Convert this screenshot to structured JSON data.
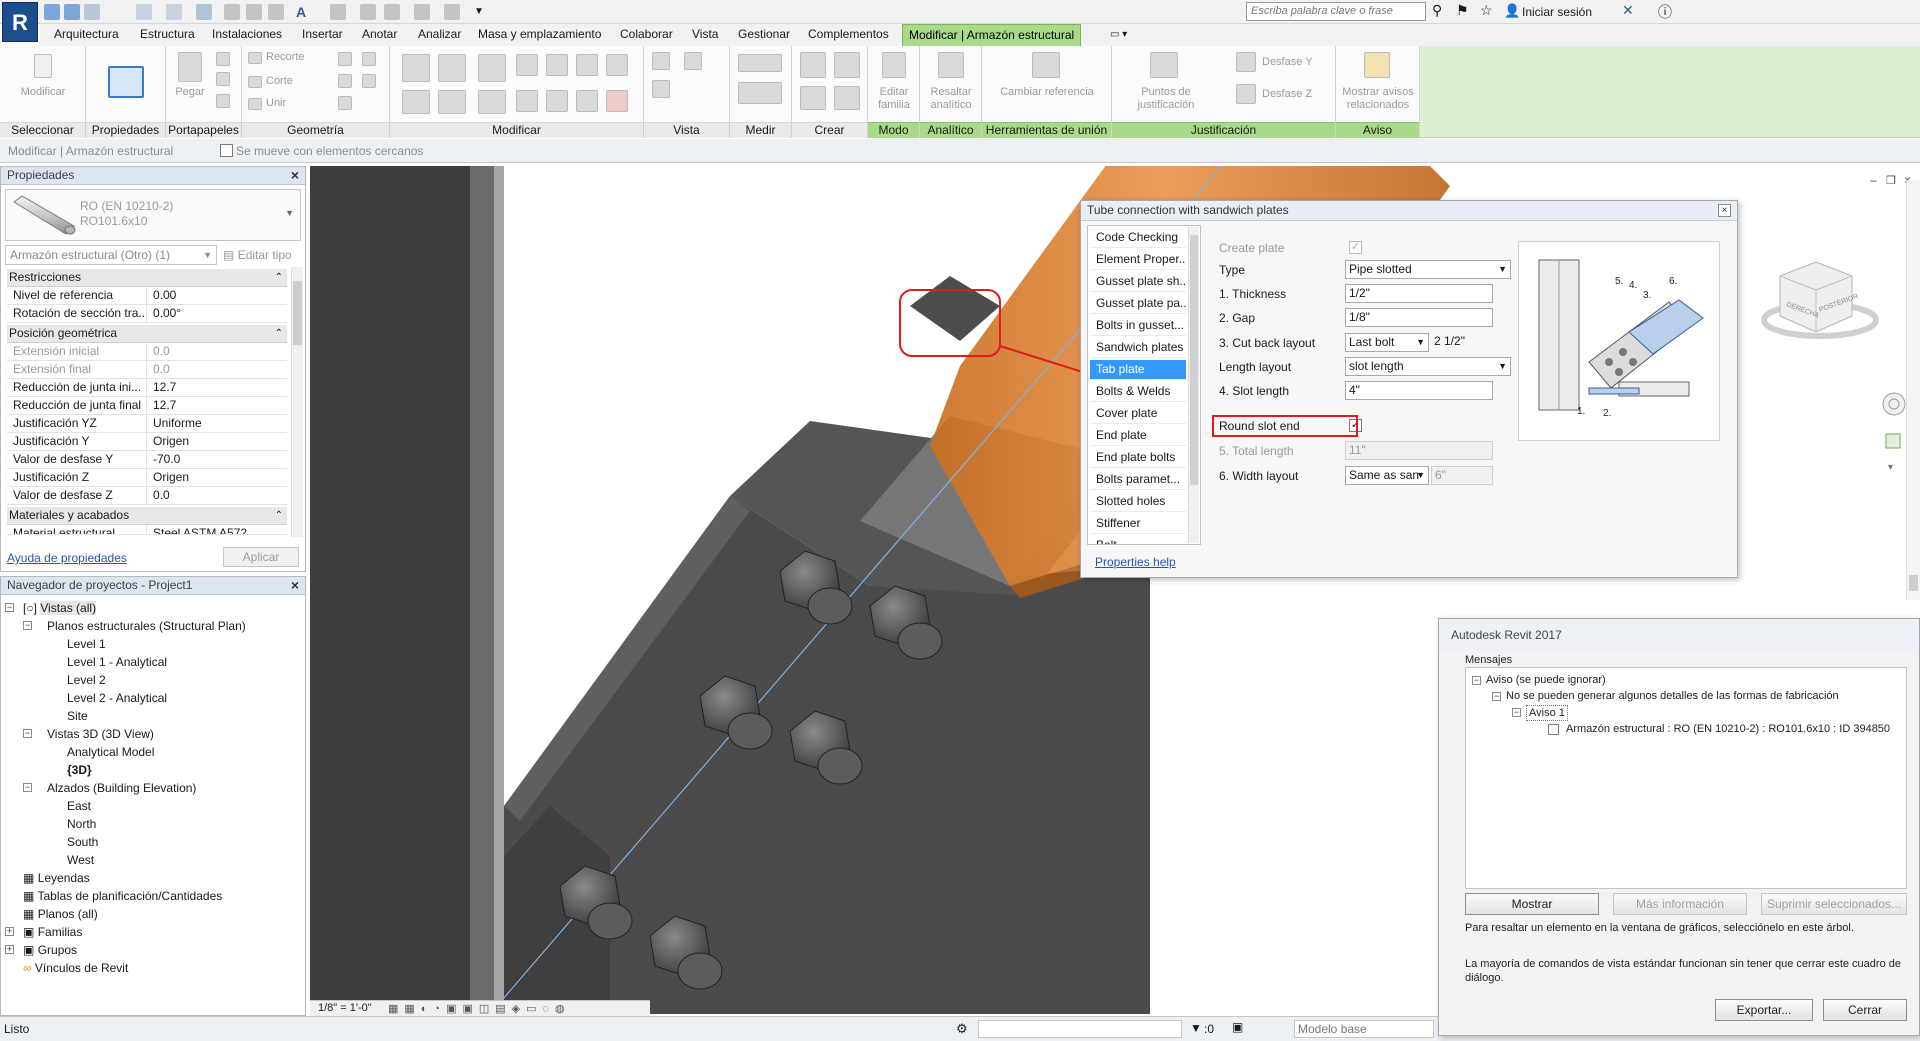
{
  "app": {
    "logo_letter": "R",
    "search_placeholder": "Escriba palabra clave o frase",
    "signin": "Iniciar sesión"
  },
  "tabs": [
    "Arquitectura",
    "Estructura",
    "Instalaciones",
    "Insertar",
    "Anotar",
    "Analizar",
    "Masa y emplazamiento",
    "Colaborar",
    "Vista",
    "Gestionar",
    "Complementos",
    "Modificar | Armazón estructural"
  ],
  "ribbon": {
    "modificar_label": "Modificar",
    "pegar_label": "Pegar",
    "recorte": "Recorte",
    "corte": "Corte",
    "unir": "Unir",
    "editar_familia": "Editar familia",
    "resaltar_analitico": "Resaltar analítico",
    "cambiar_referencia": "Cambiar referencia",
    "puntos_justificacion": "Puntos de justificación",
    "desfase_y": "Desfase Y",
    "desfase_z": "Desfase Z",
    "mostrar_avisos": "Mostrar avisos relacionados",
    "panels": [
      "Seleccionar",
      "Propiedades",
      "Portapapeles",
      "Geometría",
      "Modificar",
      "Vista",
      "Medir",
      "Crear",
      "Modo",
      "Analítico",
      "Herramientas de unión",
      "Justificación",
      "Aviso"
    ]
  },
  "options_bar": {
    "context": "Modificar | Armazón estructural",
    "moves_with_nearby": "Se mueve con elementos cercanos"
  },
  "properties": {
    "title": "Propiedades",
    "type_line1": "RO (EN 10210-2)",
    "type_line2": "RO101.6x10",
    "instance_filter": "Armazón estructural (Otro) (1)",
    "edit_type": "Editar tipo",
    "groups": {
      "restricciones": "Restricciones",
      "posicion": "Posición geométrica",
      "materiales": "Materiales y acabados"
    },
    "rows_restricciones": [
      {
        "k": "Nivel de referencia",
        "v": "0.00"
      },
      {
        "k": "Rotación de sección tra...",
        "v": "0.00°"
      }
    ],
    "rows_posicion": [
      {
        "k": "Extensión inicial",
        "v": "0.0"
      },
      {
        "k": "Extensión final",
        "v": "0.0"
      },
      {
        "k": "Reducción de junta ini...",
        "v": "12.7"
      },
      {
        "k": "Reducción de junta final",
        "v": "12.7"
      },
      {
        "k": "Justificación YZ",
        "v": "Uniforme"
      },
      {
        "k": "Justificación Y",
        "v": "Origen"
      },
      {
        "k": "Valor de desfase Y",
        "v": "-70.0"
      },
      {
        "k": "Justificación Z",
        "v": "Origen"
      },
      {
        "k": "Valor de desfase Z",
        "v": "0.0"
      }
    ],
    "rows_materiales": [
      {
        "k": "Material estructural",
        "v": "Steel ASTM A572"
      }
    ],
    "help_link": "Ayuda de propiedades",
    "apply": "Aplicar"
  },
  "browser": {
    "title": "Navegador de proyectos - Project1",
    "root": "Vistas (all)",
    "plans": "Planos estructurales (Structural Plan)",
    "plan_items": [
      "Level 1",
      "Level 1 - Analytical",
      "Level 2",
      "Level 2 - Analytical",
      "Site"
    ],
    "views3d": "Vistas 3D (3D View)",
    "views3d_items": [
      "Analytical Model",
      "{3D}"
    ],
    "elevations": "Alzados (Building Elevation)",
    "elevation_items": [
      "East",
      "North",
      "South",
      "West"
    ],
    "others": [
      "Leyendas",
      "Tablas de planificación/Cantidades",
      "Planos (all)",
      "Familias",
      "Grupos",
      "Vínculos de Revit"
    ]
  },
  "viewport": {
    "scale": "1/8\" = 1'-0\""
  },
  "status": {
    "text": "Listo",
    "filter_count": ":0",
    "model": "Modelo base"
  },
  "tube_dialog": {
    "title": "Tube connection with sandwich plates",
    "nav": [
      "Code Checking",
      "Element Proper...",
      "Gusset plate sh...",
      "Gusset plate pa...",
      "Bolts in gusset...",
      "Sandwich plates",
      "Tab plate",
      "Bolts & Welds",
      "Cover plate",
      "End plate",
      "End plate bolts",
      "Bolts  paramet...",
      "Slotted holes",
      "Stiffener",
      "Bolt..."
    ],
    "selected_index": 6,
    "fields": {
      "create_plate": "Create plate",
      "type": "Type",
      "type_value": "Pipe slotted",
      "thickness": "1. Thickness",
      "thickness_value": "1/2\"",
      "gap": "2. Gap",
      "gap_value": "1/8\"",
      "cut_back": "3. Cut back layout",
      "cut_back_value": "Last bolt",
      "cut_back_dim": "2 1/2\"",
      "length_layout": "Length layout",
      "length_layout_value": "slot length",
      "slot_length": "4. Slot length",
      "slot_length_value": "4\"",
      "round_slot_end": "Round slot end",
      "total_length": "5. Total length",
      "total_length_value": "11\"",
      "width_layout": "6. Width layout",
      "width_layout_value": "Same as san",
      "width_value": "6\""
    },
    "preview_labels": [
      "1.",
      "2.",
      "3.",
      "4.",
      "5.",
      "6."
    ],
    "help": "Properties help"
  },
  "warning_dialog": {
    "title": "Autodesk Revit 2017",
    "messages_label": "Mensajes",
    "tree": [
      "Aviso (se puede ignorar)",
      "No se pueden generar algunos detalles de las formas de fabricación",
      "Aviso 1",
      "Armazón estructural : RO (EN 10210-2) : RO101.6x10 : ID 394850"
    ],
    "show": "Mostrar",
    "more_info": "Más información",
    "delete_selected": "Suprimir seleccionados...",
    "hint1": "Para resaltar un elemento en la ventana de gráficos, selecciónelo en este árbol.",
    "hint2": "La mayoría de comandos de vista estándar funcionan sin tener que cerrar este cuadro de diálogo.",
    "export": "Exportar...",
    "close": "Cerrar"
  },
  "viewcube": {
    "face_left": "DERECHA",
    "face_right": "POSTERIOR"
  },
  "colors": {
    "ribbon_accent": "#a9d98b",
    "tube": "#e8893a",
    "steel": "#5a5a5a",
    "callout": "#e31a1a",
    "selection": "#3399ff"
  }
}
